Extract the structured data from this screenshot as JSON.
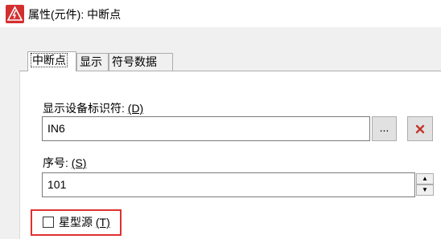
{
  "window": {
    "title": "属性(元件): 中断点"
  },
  "tabs": [
    {
      "label": "中断点",
      "active": true
    },
    {
      "label": "显示",
      "active": false
    },
    {
      "label": "符号数据",
      "active": false
    }
  ],
  "display_device_id": {
    "label": "显示设备标识符: ",
    "mnemonic": "(D)",
    "value": "IN6",
    "browse_label": "...",
    "clear_icon": "red-x-icon"
  },
  "sequence_number": {
    "label": "序号: ",
    "mnemonic": "(S)",
    "value": "101",
    "up_arrow": "▲",
    "down_arrow": "▼"
  },
  "star_source": {
    "label": "星型源 ",
    "mnemonic": "(T)",
    "checked": false
  },
  "colors": {
    "highlight": "#e03030",
    "clear_icon": "#c0392b",
    "app_icon": "#d32f2f"
  }
}
